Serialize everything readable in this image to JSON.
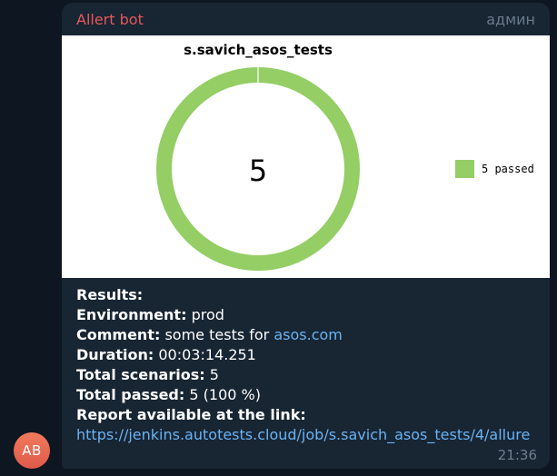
{
  "message": {
    "avatar_initials": "AB",
    "sender": "Allert bot",
    "role": "админ",
    "time": "21:36"
  },
  "chart_data": {
    "type": "pie",
    "title": "s.savich_asos_tests",
    "center_label": "5",
    "slices": [
      {
        "label": "5 passed",
        "value": 5,
        "color": "#94ce65"
      }
    ],
    "legend_position": "right"
  },
  "report": {
    "results_label": "Results:",
    "environment_label": "Environment:",
    "environment_value": "prod",
    "comment_label": "Comment:",
    "comment_text": "some tests for",
    "comment_link": "asos.com",
    "duration_label": "Duration:",
    "duration_value": "00:03:14.251",
    "scenarios_label": "Total scenarios:",
    "scenarios_value": "5",
    "passed_label": "Total passed:",
    "passed_value": "5 (100 %)",
    "report_label": "Report available at the link:",
    "report_link": "https://jenkins.autotests.cloud/job/s.savich_asos_tests/4/allure"
  }
}
